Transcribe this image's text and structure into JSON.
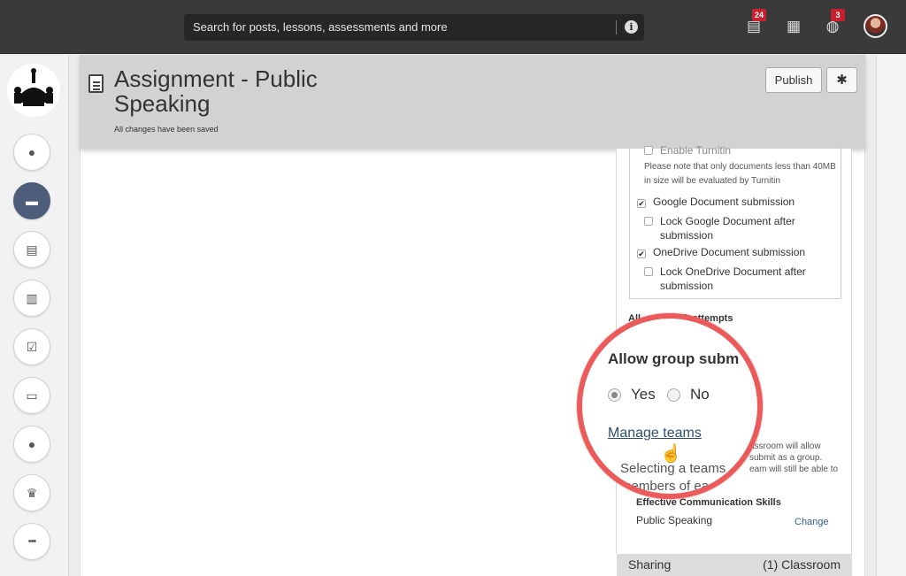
{
  "topbar": {
    "search_placeholder": "Search for posts, lessons, assessments and more",
    "info_glyph": "i",
    "notifications": [
      {
        "icon": "document-notification-icon",
        "glyph": "▤",
        "badge": "24"
      },
      {
        "icon": "calendar-icon",
        "glyph": "▦",
        "badge": ""
      },
      {
        "icon": "globe-icon",
        "glyph": "◍",
        "badge": "3"
      }
    ],
    "badge_color": "#c8202f"
  },
  "rail": {
    "active_color": "#4d5d7a",
    "items": [
      {
        "name": "rail-messages",
        "icon": "chat-bubble-icon",
        "glyph": "●"
      },
      {
        "name": "rail-folder",
        "icon": "folder-icon",
        "glyph": "▬",
        "active": true
      },
      {
        "name": "rail-newspaper",
        "icon": "newspaper-icon",
        "glyph": "▤"
      },
      {
        "name": "rail-analytics",
        "icon": "bar-chart-icon",
        "glyph": "▥"
      },
      {
        "name": "rail-tasks",
        "icon": "checkbox-icon",
        "glyph": "☑"
      },
      {
        "name": "rail-monitor",
        "icon": "monitor-icon",
        "glyph": "▭"
      },
      {
        "name": "rail-profile",
        "icon": "user-icon",
        "glyph": "●"
      },
      {
        "name": "rail-trophy",
        "icon": "trophy-icon",
        "glyph": "♛"
      },
      {
        "name": "rail-more",
        "icon": "more-icon",
        "glyph": "•••"
      }
    ]
  },
  "header": {
    "title": "Assignment - Public Speaking",
    "saved_status": "All changes have been saved",
    "publish_label": "Publish",
    "settings_glyph": "✱"
  },
  "panel": {
    "turnitin_label": "Enable Turnitin",
    "turnitin_note": "Please note that only documents less than 40MB in size will be evaluated by Turnitin",
    "google_label": "Google Document submission",
    "google_checked": "✔",
    "lock_google_label": "Lock Google Document after submission",
    "onedrive_label": "OneDrive Document submission",
    "onedrive_checked": "✔",
    "lock_onedrive_label": "Lock OneDrive Document after submission",
    "draft_attempts_label": "draft attempts",
    "draft_attempts_prefix": "All",
    "group_note_lines": [
      "assroom will allow",
      "submit as a group.",
      "eam will still be able to"
    ],
    "skill_title": "Effective Communication Skills",
    "skill_value": "Public Speaking",
    "change_link": "Change"
  },
  "zoom": {
    "heading": "Allow group subm",
    "yes_label": "Yes",
    "no_label": "No",
    "selected": "Yes",
    "manage_teams_link": "Manage teams",
    "faded_text": "Selecting a teams members of ea",
    "ring_color": "#ec5b5b"
  },
  "sharing": {
    "label": "Sharing",
    "value": "(1) Classroom"
  }
}
